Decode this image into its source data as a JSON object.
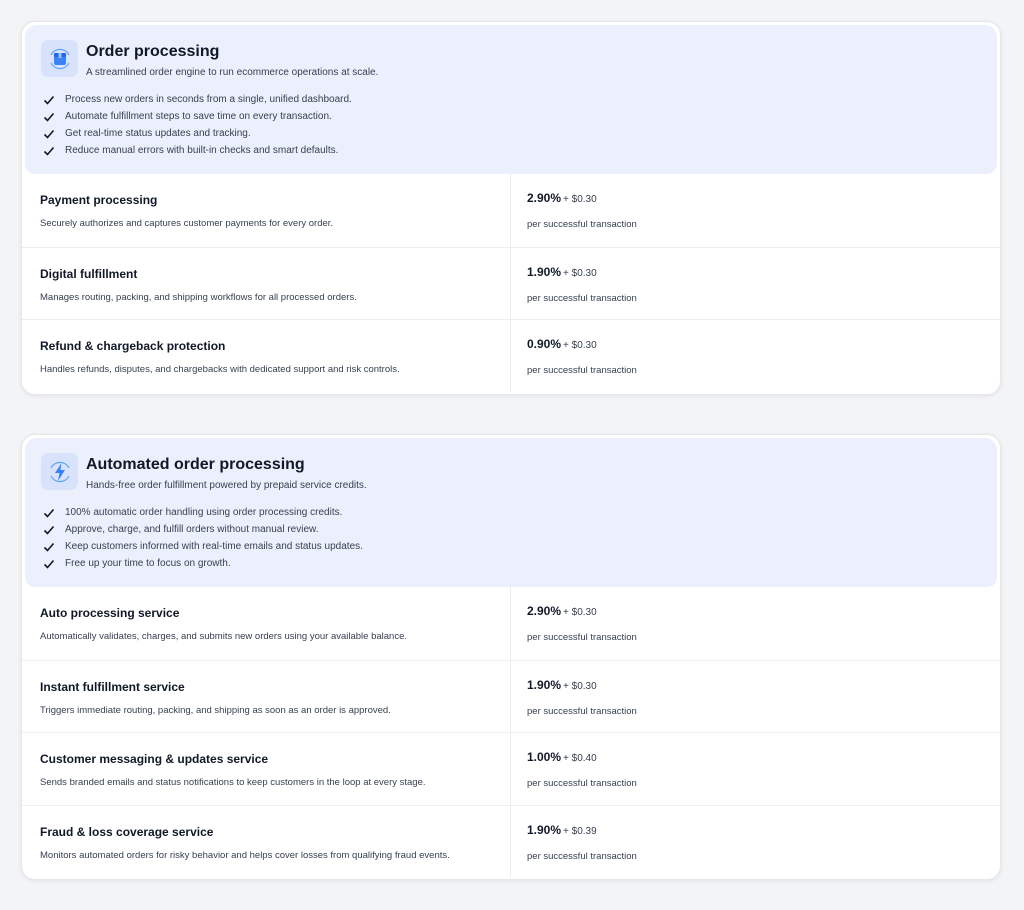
{
  "sections": [
    {
      "title": "Order processing",
      "subtitle": "A streamlined order engine to run ecommerce operations at scale.",
      "icon": "package-icon",
      "features": [
        "Process new orders in seconds from a single, unified dashboard.",
        "Automate fulfillment steps to save time on every transaction.",
        "Get real-time status updates and tracking.",
        "Reduce manual errors with built-in checks and smart defaults."
      ],
      "services": [
        {
          "name": "Payment processing",
          "description": "Securely authorizes and captures customer payments for every order.",
          "rate": "2.90%",
          "fee": "+ $0.30",
          "unit": "per successful transaction"
        },
        {
          "name": "Digital fulfillment",
          "description": "Manages routing, packing, and shipping workflows for all processed orders.",
          "rate": "1.90%",
          "fee": "+ $0.30",
          "unit": "per successful transaction"
        },
        {
          "name": "Refund & chargeback protection",
          "description": "Handles refunds, disputes, and chargebacks with dedicated support and risk controls.",
          "rate": "0.90%",
          "fee": "+ $0.30",
          "unit": "per successful transaction"
        }
      ]
    },
    {
      "title": "Automated order processing",
      "subtitle": "Hands-free order fulfillment powered by prepaid service credits.",
      "icon": "lightning-icon",
      "features": [
        "100% automatic order handling using order processing credits.",
        "Approve, charge, and fulfill orders without manual review.",
        "Keep customers informed with real-time emails and status updates.",
        "Free up your time to focus on growth."
      ],
      "services": [
        {
          "name": "Auto processing service",
          "description": "Automatically validates, charges, and submits new orders using your available balance.",
          "rate": "2.90%",
          "fee": "+ $0.30",
          "unit": "per successful transaction"
        },
        {
          "name": "Instant fulfillment service",
          "description": "Triggers immediate routing, packing, and shipping as soon as an order is approved.",
          "rate": "1.90%",
          "fee": "+ $0.30",
          "unit": "per successful transaction"
        },
        {
          "name": "Customer messaging & updates service",
          "description": "Sends branded emails and status notifications to keep customers in the loop at every stage.",
          "rate": "1.00%",
          "fee": "+ $0.40",
          "unit": "per successful transaction"
        },
        {
          "name": "Fraud & loss coverage service",
          "description": "Monitors automated orders for risky behavior and helps cover losses from qualifying fraud events.",
          "rate": "1.90%",
          "fee": "+ $0.39",
          "unit": "per successful transaction"
        }
      ]
    }
  ],
  "colors": {
    "header_bg": "#ebf0fc",
    "icon_bg": "#d8e3fb",
    "accent": "#3b82f6"
  }
}
